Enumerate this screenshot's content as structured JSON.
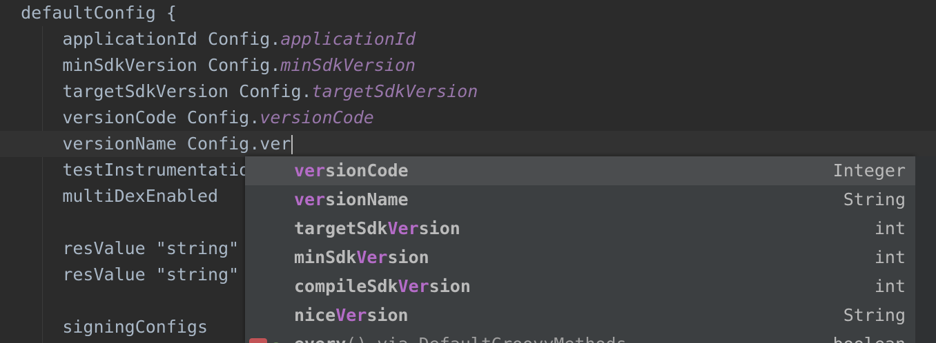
{
  "editor": {
    "lines": [
      {
        "text": "defaultConfig {"
      },
      {
        "text": "applicationId Config.",
        "field": "applicationId"
      },
      {
        "text": "minSdkVersion Config.",
        "field": "minSdkVersion"
      },
      {
        "text": "targetSdkVersion Config.",
        "field": "targetSdkVersion"
      },
      {
        "text": "versionCode Config.",
        "field": "versionCode"
      },
      {
        "text": "versionName Config.ver"
      },
      {
        "text": "testInstrumentation"
      },
      {
        "text": "multiDexEnabled"
      },
      {
        "text": "resValue \"string\""
      },
      {
        "text": "resValue \"string\""
      },
      {
        "text": "signingConfigs"
      }
    ]
  },
  "completion": {
    "items": [
      {
        "match": "ver",
        "rest": "sionCode",
        "type": "Integer"
      },
      {
        "match": "ver",
        "rest": "sionName",
        "type": "String"
      },
      {
        "prefix": "targetSdk",
        "match": "Ver",
        "rest": "sion",
        "type": "int"
      },
      {
        "prefix": "minSdk",
        "match": "Ver",
        "rest": "sion",
        "type": "int"
      },
      {
        "prefix": "compileSdk",
        "match": "Ver",
        "rest": "sion",
        "type": "int"
      },
      {
        "prefix": "nice",
        "match": "Ver",
        "rest": "sion",
        "type": "String"
      },
      {
        "match": "every",
        "rest": "()",
        "suffix": " via DefaultGroovyMethods",
        "type": "boolean",
        "icon": "m"
      }
    ]
  }
}
